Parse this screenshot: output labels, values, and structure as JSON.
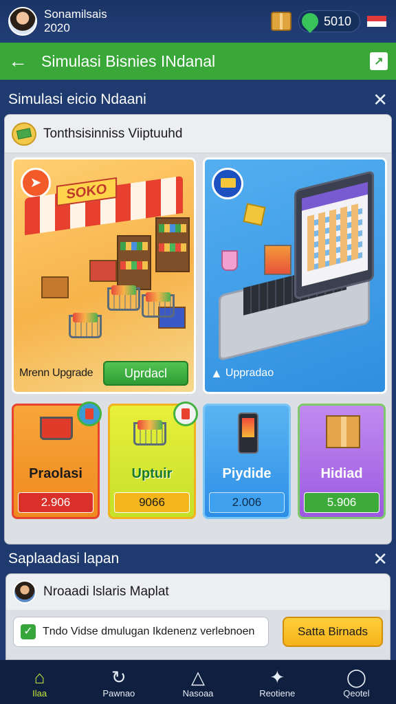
{
  "profile": {
    "name": "Sonamilsais",
    "year": "2020"
  },
  "wallet": {
    "coins": "5010"
  },
  "header": {
    "title": "Simulasi Bisnies INdanal"
  },
  "section1": {
    "title": "Simulasi eicio Ndaani"
  },
  "panel": {
    "title": "Tonthsisinniss Viiptuuhd"
  },
  "cards": {
    "store": {
      "sign": "SOKO",
      "label": "Mrenn Upgrade",
      "button": "Uprdacl"
    },
    "online": {
      "label": "Uppradao"
    }
  },
  "items": [
    {
      "title": "Praolasi",
      "price": "2.906"
    },
    {
      "title": "Uptuir",
      "price": "9066"
    },
    {
      "title": "Piydide",
      "price": "2.006"
    },
    {
      "title": "Hidiad",
      "price": "5.906"
    }
  ],
  "section2": {
    "title": "Saplaadasi lapan"
  },
  "panel2": {
    "title": "Nroaadi lslaris Maplat",
    "todo": "Tndo Vidse dmulugan Ikdenenz verlebnoen",
    "save_button": "Satta Birnads"
  },
  "nav": [
    {
      "label": "Ilaa",
      "icon": "home-icon"
    },
    {
      "label": "Pawnao",
      "icon": "refresh-icon"
    },
    {
      "label": "Nasoaa",
      "icon": "triangle-icon"
    },
    {
      "label": "Reotiene",
      "icon": "wrench-icon"
    },
    {
      "label": "Qeotel",
      "icon": "search-icon"
    }
  ],
  "colors": {
    "header_green": "#3aa739",
    "background_navy": "#1e3a6e",
    "accent_lime": "#c5e63a"
  }
}
